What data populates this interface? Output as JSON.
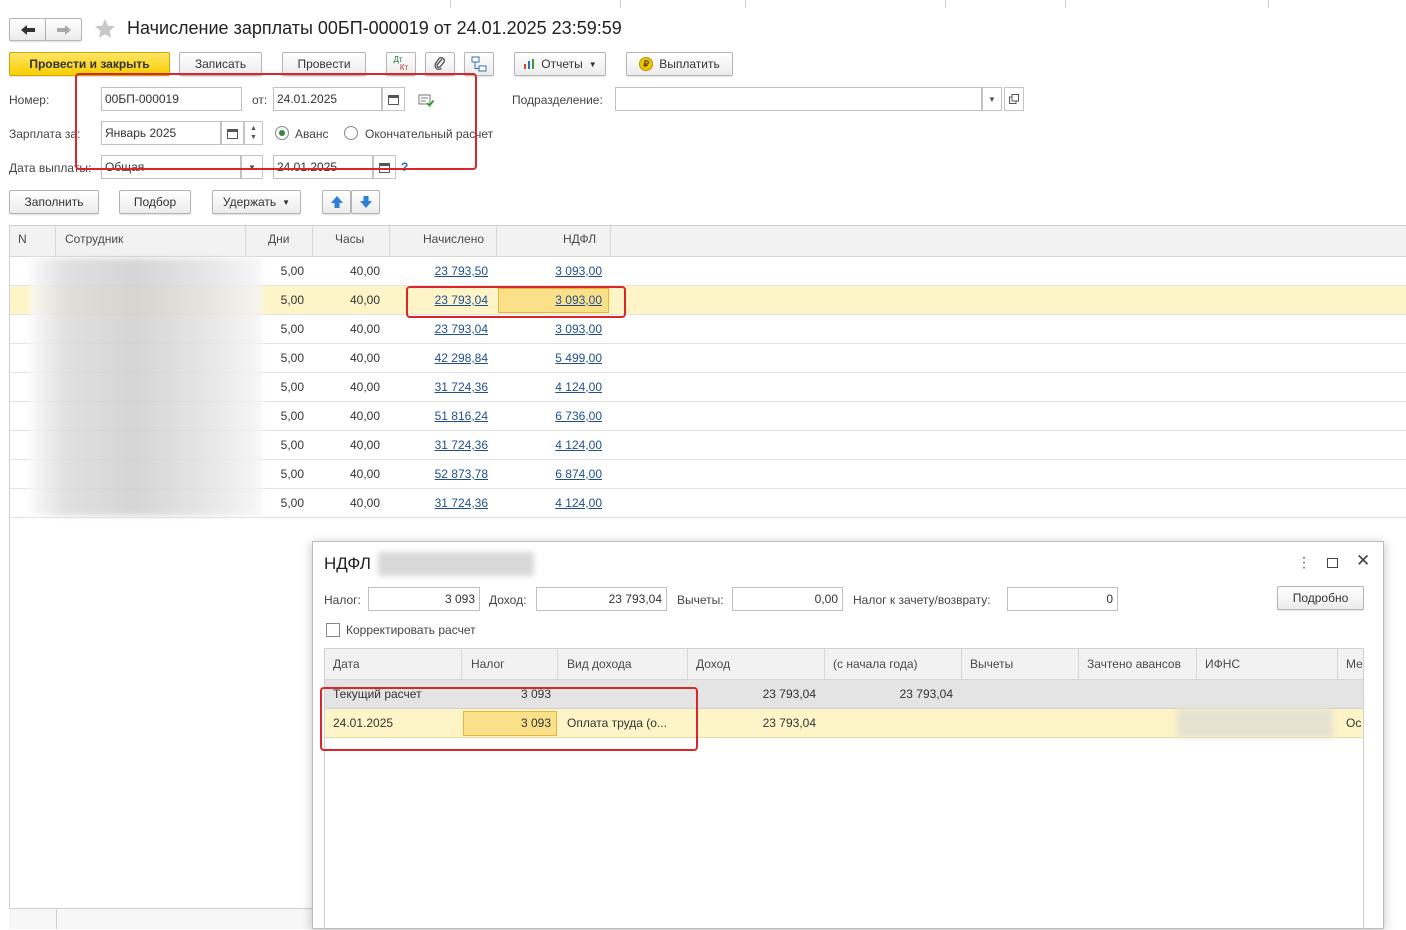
{
  "window": {
    "title": "Начисление зарплаты 00БП-000019 от 24.01.2025 23:59:59"
  },
  "toolbar": {
    "post_close": "Провести и закрыть",
    "save": "Записать",
    "post": "Провести",
    "dtkt_top": "Дт",
    "dtkt_bottom": "Кт",
    "reports": "Отчеты",
    "pay": "Выплатить"
  },
  "form": {
    "number_label": "Номер:",
    "number_value": "00БП-000019",
    "date_label": "от:",
    "date_value": "24.01.2025",
    "division_label": "Подразделение:",
    "division_value": "",
    "salary_for_label": "Зарплата за:",
    "salary_for_value": "Январь 2025",
    "advance_label": "Аванс",
    "final_label": "Окончательный расчет",
    "pay_date_label": "Дата выплаты:",
    "pay_date_type": "Общая",
    "pay_date_value": "24.01.2025",
    "help": "?"
  },
  "table_toolbar": {
    "fill": "Заполнить",
    "pick": "Подбор",
    "withhold": "Удержать"
  },
  "table": {
    "headers": {
      "n": "N",
      "employee": "Сотрудник",
      "days": "Дни",
      "hours": "Часы",
      "accrued": "Начислено",
      "ndfl": "НДФЛ"
    },
    "rows": [
      {
        "days": "5,00",
        "hours": "40,00",
        "accrued": "23 793,50",
        "ndfl": "3 093,00"
      },
      {
        "days": "5,00",
        "hours": "40,00",
        "accrued": "23 793,04",
        "ndfl": "3 093,00"
      },
      {
        "days": "5,00",
        "hours": "40,00",
        "accrued": "23 793,04",
        "ndfl": "3 093,00"
      },
      {
        "days": "5,00",
        "hours": "40,00",
        "accrued": "42 298,84",
        "ndfl": "5 499,00"
      },
      {
        "days": "5,00",
        "hours": "40,00",
        "accrued": "31 724,36",
        "ndfl": "4 124,00"
      },
      {
        "days": "5,00",
        "hours": "40,00",
        "accrued": "51 816,24",
        "ndfl": "6 736,00"
      },
      {
        "days": "5,00",
        "hours": "40,00",
        "accrued": "31 724,36",
        "ndfl": "4 124,00"
      },
      {
        "days": "5,00",
        "hours": "40,00",
        "accrued": "52 873,78",
        "ndfl": "6 874,00"
      },
      {
        "days": "5,00",
        "hours": "40,00",
        "accrued": "31 724,36",
        "ndfl": "4 124,00"
      }
    ]
  },
  "dialog": {
    "title": "НДФЛ",
    "tax_label": "Налог:",
    "tax_value": "3 093",
    "income_label": "Доход:",
    "income_value": "23 793,04",
    "deductions_label": "Вычеты:",
    "deductions_value": "0,00",
    "offset_label": "Налог к зачету/возврату:",
    "offset_value": "0",
    "details_button": "Подробно",
    "adjust_label": "Корректировать расчет",
    "headers": {
      "date": "Дата",
      "tax": "Налог",
      "income_type": "Вид дохода",
      "income": "Доход",
      "ytd": "(с начала года)",
      "deductions": "Вычеты",
      "advances": "Зачтено авансов",
      "ifns": "ИФНС",
      "more": "Ме"
    },
    "rows": [
      {
        "date": "Текущий расчет",
        "tax": "3 093",
        "income_type": "",
        "income": "23 793,04",
        "ytd": "23 793,04",
        "more": ""
      },
      {
        "date": "24.01.2025",
        "tax": "3 093",
        "income_type": "Оплата труда (о...",
        "income": "23 793,04",
        "ytd": "",
        "more": "Ос"
      }
    ]
  }
}
